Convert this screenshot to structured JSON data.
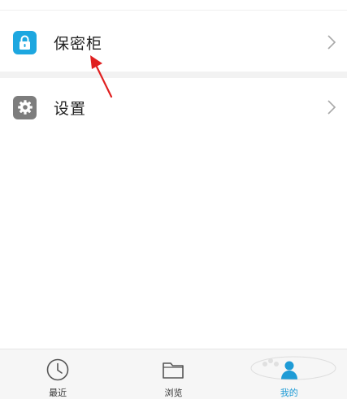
{
  "colors": {
    "accent": "#1e9bd6",
    "vault_icon_bg": "#1da7e0",
    "settings_icon_bg": "#7d7d7d",
    "annotation_arrow": "#e02020"
  },
  "menu": {
    "vault": {
      "label": "保密柜",
      "icon": "lock-icon"
    },
    "settings": {
      "label": "设置",
      "icon": "gear-icon"
    }
  },
  "tabs": [
    {
      "label": "最近",
      "icon": "clock-icon",
      "active": false
    },
    {
      "label": "浏览",
      "icon": "folder-icon",
      "active": false
    },
    {
      "label": "我的",
      "icon": "profile-icon",
      "active": true
    }
  ]
}
